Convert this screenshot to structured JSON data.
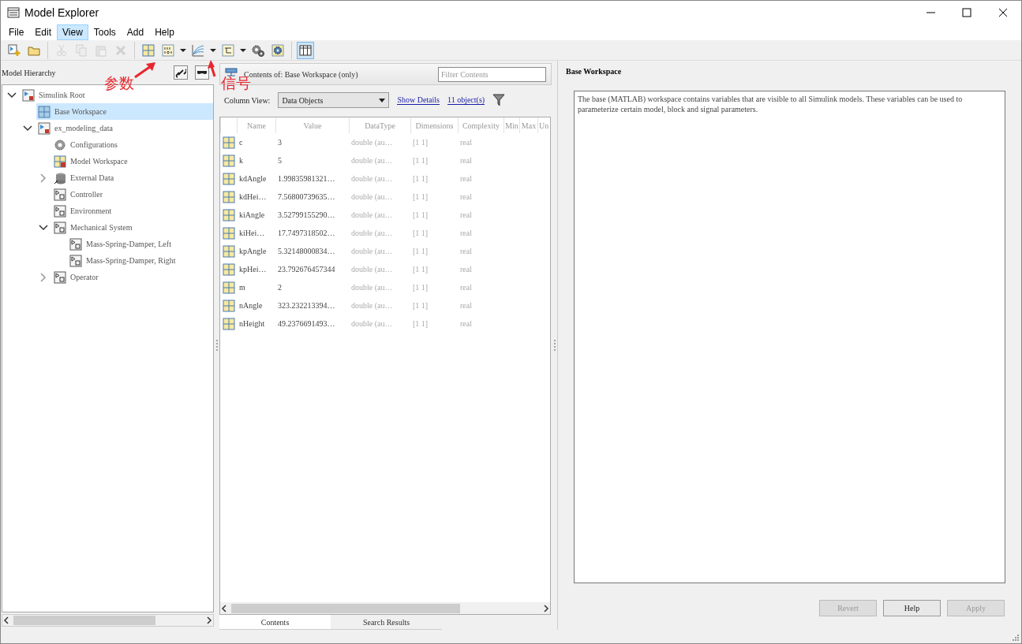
{
  "window": {
    "title": "Model Explorer"
  },
  "menu": [
    {
      "label": "File",
      "selected": false
    },
    {
      "label": "Edit",
      "selected": false
    },
    {
      "label": "View",
      "selected": true
    },
    {
      "label": "Tools",
      "selected": false
    },
    {
      "label": "Add",
      "selected": false
    },
    {
      "label": "Help",
      "selected": false
    }
  ],
  "toolbar": [
    {
      "kind": "new",
      "disabled": false
    },
    {
      "kind": "open",
      "disabled": false
    },
    {
      "kind": "sep"
    },
    {
      "kind": "cut",
      "disabled": true
    },
    {
      "kind": "copy",
      "disabled": true
    },
    {
      "kind": "paste",
      "disabled": true
    },
    {
      "kind": "delete",
      "disabled": true
    },
    {
      "kind": "sep"
    },
    {
      "kind": "grid",
      "disabled": false
    },
    {
      "kind": "binary",
      "disabled": false
    },
    {
      "kind": "dropdown",
      "disabled": false
    },
    {
      "kind": "signal",
      "disabled": false
    },
    {
      "kind": "dropdown",
      "disabled": false
    },
    {
      "kind": "bus",
      "disabled": false
    },
    {
      "kind": "dropdown",
      "disabled": false
    },
    {
      "kind": "gears",
      "disabled": false
    },
    {
      "kind": "config",
      "disabled": false
    },
    {
      "kind": "sep"
    },
    {
      "kind": "columns",
      "disabled": false,
      "on": true
    }
  ],
  "annotations": [
    {
      "text": "参数"
    },
    {
      "text": "信号"
    }
  ],
  "hierarchy": {
    "title": "Model Hierarchy",
    "tree": [
      {
        "label": "Simulink Root",
        "kind": "model",
        "expanded": true,
        "selected": false,
        "children": [
          {
            "label": "Base Workspace",
            "kind": "workspace",
            "selected": true
          },
          {
            "label": "ex_modeling_data",
            "kind": "model",
            "expanded": true,
            "selected": false,
            "children": [
              {
                "label": "Configurations",
                "kind": "config",
                "selected": false
              },
              {
                "label": "Model Workspace",
                "kind": "model-workspace",
                "selected": false
              },
              {
                "label": "External Data",
                "kind": "database",
                "expanded": false,
                "selected": false
              },
              {
                "label": "Controller",
                "kind": "subsystem",
                "selected": false
              },
              {
                "label": "Environment",
                "kind": "subsystem",
                "selected": false
              },
              {
                "label": "Mechanical System",
                "kind": "subsystem",
                "expanded": true,
                "selected": false,
                "children": [
                  {
                    "label": "Mass-Spring-Damper, Left",
                    "kind": "subsystem",
                    "selected": false
                  },
                  {
                    "label": "Mass-Spring-Damper, Right",
                    "kind": "subsystem",
                    "selected": false
                  }
                ]
              },
              {
                "label": "Operator",
                "kind": "subsystem",
                "expanded": false,
                "selected": false
              }
            ]
          }
        ]
      }
    ]
  },
  "contents": {
    "title": "Contents of: Base Workspace (only)",
    "filter": {
      "placeholder": "Filter Contents"
    },
    "column_view_label": "Column View:",
    "column_view": "Data Objects",
    "show_details": "Show Details",
    "count": "11 object(s)",
    "columns": [
      "Name",
      "Value",
      "DataType",
      "Dimensions",
      "Complexity",
      "Min",
      "Max",
      "Un"
    ],
    "rows": [
      [
        "c",
        "3",
        "double (au…",
        "[1 1]",
        "real"
      ],
      [
        "k",
        "5",
        "double (au…",
        "[1 1]",
        "real"
      ],
      [
        "kdAngle",
        "1.99835981321…",
        "double (au…",
        "[1 1]",
        "real"
      ],
      [
        "kdHei…",
        "7.56800739635…",
        "double (au…",
        "[1 1]",
        "real"
      ],
      [
        "kiAngle",
        "3.52799155290…",
        "double (au…",
        "[1 1]",
        "real"
      ],
      [
        "kiHei…",
        "17.7497318502…",
        "double (au…",
        "[1 1]",
        "real"
      ],
      [
        "kpAngle",
        "5.32148000834…",
        "double (au…",
        "[1 1]",
        "real"
      ],
      [
        "kpHei…",
        "23.792676457344",
        "double (au…",
        "[1 1]",
        "real"
      ],
      [
        "m",
        "2",
        "double (au…",
        "[1 1]",
        "real"
      ],
      [
        "nAngle",
        "323.232213394…",
        "double (au…",
        "[1 1]",
        "real"
      ],
      [
        "nHeight",
        "49.2376691493…",
        "double (au…",
        "[1 1]",
        "real"
      ]
    ],
    "tabs": [
      {
        "label": "Contents",
        "selected": true
      },
      {
        "label": "Search Results",
        "selected": false
      }
    ]
  },
  "details": {
    "title": "Base Workspace",
    "description": "The base (MATLAB) workspace contains variables that are visible to all Simulink models. These variables can be used to parameterize certain model, block and signal parameters.",
    "buttons": [
      {
        "label": "Revert",
        "disabled": true
      },
      {
        "label": "Help",
        "disabled": false
      },
      {
        "label": "Apply",
        "disabled": true
      }
    ]
  }
}
